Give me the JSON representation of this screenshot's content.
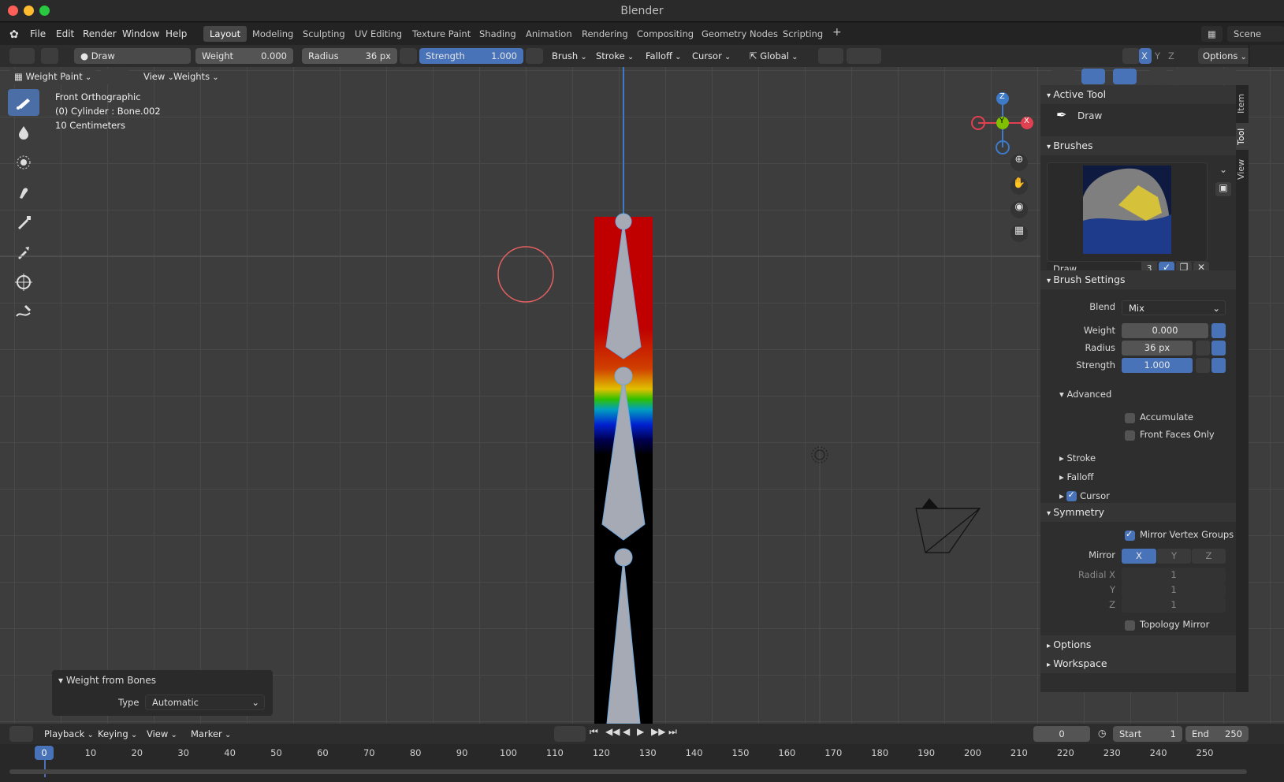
{
  "window": {
    "title": "Blender"
  },
  "menu": [
    "File",
    "Edit",
    "Render",
    "Window",
    "Help"
  ],
  "workspaces": [
    "Layout",
    "Modeling",
    "Sculpting",
    "UV Editing",
    "Texture Paint",
    "Shading",
    "Animation",
    "Rendering",
    "Compositing",
    "Geometry Nodes",
    "Scripting"
  ],
  "active_workspace": "Layout",
  "scene": "Scene",
  "tool_header": {
    "brush_name": "Draw",
    "weight_label": "Weight",
    "weight_value": "0.000",
    "radius_label": "Radius",
    "radius_value": "36 px",
    "strength_label": "Strength",
    "strength_value": "1.000",
    "menus": [
      "Brush",
      "Stroke",
      "Falloff",
      "Cursor"
    ],
    "orientation": "Global",
    "axes": [
      "X",
      "Y",
      "Z"
    ],
    "options": "Options"
  },
  "viewport_header": {
    "mode": "Weight Paint",
    "menus": [
      "View",
      "Weights"
    ]
  },
  "viewport_info": {
    "view": "Front Orthographic",
    "object": "(0) Cylinder : Bone.002",
    "scale": "10 Centimeters"
  },
  "gizmo": {
    "z": "Z",
    "y": "Y",
    "x": "X"
  },
  "last_op": {
    "title": "Weight from Bones",
    "type_label": "Type",
    "type_value": "Automatic"
  },
  "npanel": {
    "active_tool": {
      "title": "Active Tool",
      "tool": "Draw"
    },
    "brushes": {
      "title": "Brushes",
      "name": "Draw",
      "users": "3"
    },
    "brush_settings": {
      "title": "Brush Settings",
      "blend_label": "Blend",
      "blend_value": "Mix",
      "weight_label": "Weight",
      "weight_value": "0.000",
      "radius_label": "Radius",
      "radius_value": "36 px",
      "strength_label": "Strength",
      "strength_value": "1.000",
      "advanced": "Advanced",
      "accumulate": "Accumulate",
      "front_faces": "Front Faces Only",
      "stroke": "Stroke",
      "falloff": "Falloff",
      "cursor": "Cursor"
    },
    "symmetry": {
      "title": "Symmetry",
      "mirror_vg": "Mirror Vertex Groups",
      "mirror_label": "Mirror",
      "radial_x_label": "Radial X",
      "radial_y_label": "Y",
      "radial_z_label": "Z",
      "radial_x": "1",
      "radial_y": "1",
      "radial_z": "1",
      "topology": "Topology Mirror"
    },
    "options": "Options",
    "workspace": "Workspace",
    "tabs": [
      "Item",
      "Tool",
      "View"
    ]
  },
  "timeline": {
    "menus": [
      "Playback",
      "Keying",
      "View",
      "Marker"
    ],
    "current_frame": "0",
    "start_label": "Start",
    "start": "1",
    "end_label": "End",
    "end": "250",
    "ticks": [
      "0",
      "10",
      "20",
      "30",
      "40",
      "50",
      "60",
      "70",
      "80",
      "90",
      "100",
      "110",
      "120",
      "130",
      "140",
      "150",
      "160",
      "170",
      "180",
      "190",
      "200",
      "210",
      "220",
      "230",
      "240",
      "250"
    ]
  }
}
